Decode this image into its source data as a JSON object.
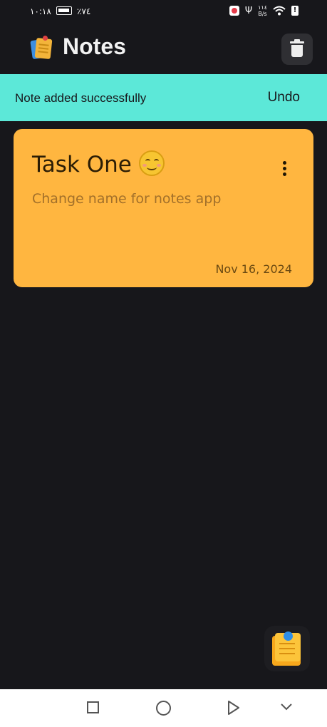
{
  "status_bar": {
    "time": "١٠:١٨",
    "battery": "٪٧٤",
    "net_speed_value": "١١٤",
    "net_speed_unit": "B/s"
  },
  "app_bar": {
    "title": "Notes",
    "logo_icon": "sticky-notes-icon",
    "delete_icon": "trash-icon"
  },
  "snackbar": {
    "message": "Note added successfully",
    "action": "Undo"
  },
  "notes": [
    {
      "title": "Task One",
      "emoji": "smiling-face-icon",
      "body": "Change name for notes app",
      "date": "Nov 16, 2024",
      "color": "#ffb640"
    }
  ],
  "fab": {
    "icon": "add-note-icon"
  },
  "colors": {
    "background": "#17171b",
    "snackbar": "#5ce8d8",
    "card": "#ffb640"
  }
}
